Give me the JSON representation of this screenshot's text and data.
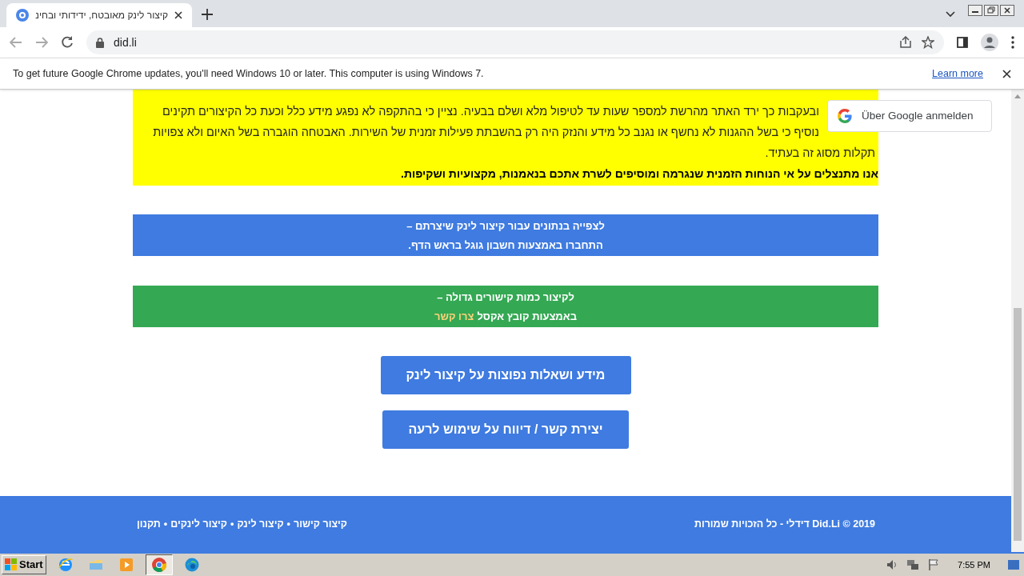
{
  "browser": {
    "tab_title": "קיצור לינק מאובטח, ידידותי ובחינ",
    "url": "did.li"
  },
  "infobar": {
    "message": "To get future Google Chrome updates, you'll need Windows 10 or later. This computer is using Windows 7.",
    "link": "Learn more"
  },
  "notice": {
    "lines": [
      "ובעקבות כך ירד האתר מהרשת למספר שעות עד לטיפול מלא ושלם בבעיה. נציין כי בהתקפה לא נפגע מידע כלל וכעת כל הקיצורים תקינים",
      "נוסיף כי בשל ההגנות לא נחשף או נגנב כל מידע והנזק היה רק בהשבתת פעילות זמנית של השירות. האבטחה הוגברה בשל האיום ולא צפויות",
      "תקלות מסוג זה בעתיד."
    ],
    "apology": "אנו מתנצלים על אי הנוחות הזמנית שנגרמה ומוסיפים לשרת אתכם בנאמנות, מקצועיות ושקיפות."
  },
  "google_signin": {
    "label": "Über Google anmelden"
  },
  "stats_banner": {
    "lines": [
      "לצפייה בנתונים עבור קיצור לינק שיצרתם –",
      "התחברו באמצעות חשבון גוגל בראש הדף."
    ]
  },
  "bulk_banner": {
    "line_1": "לקיצור כמות קישורים גדולה –",
    "line_2": "באמצעות קובץ אקסל",
    "link": "צרו קשר"
  },
  "buttons": [
    "מידע ושאלות נפוצות על קיצור לינק",
    "יצירת קשר / דיווח על שימוש לרעה"
  ],
  "footer": {
    "copyright": "2019 © Did.Li דידלי - כל הזכויות שמורות",
    "links": [
      "קיצור קישור",
      "קיצור לינק",
      "קיצור לינקים",
      "תקנון"
    ],
    "separators": [
      "•",
      "•",
      "•"
    ]
  },
  "taskbar": {
    "start": "Start",
    "clock": "7:55 PM"
  }
}
